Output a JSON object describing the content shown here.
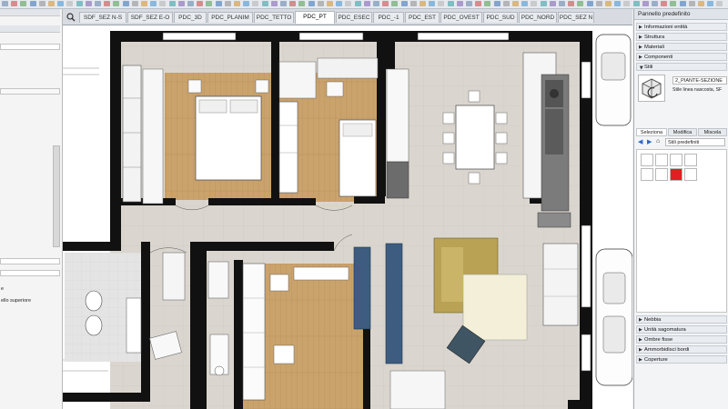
{
  "tabs": [
    {
      "label": "SDF_SEZ N-S",
      "active": false
    },
    {
      "label": "SDF_SEZ E-O",
      "active": false
    },
    {
      "label": "PDC_3D",
      "active": false
    },
    {
      "label": "PDC_PLANIM",
      "active": false
    },
    {
      "label": "PDC_TETTO",
      "active": false
    },
    {
      "label": "PDC_PT",
      "active": true
    },
    {
      "label": "PDC_ESEC",
      "active": false
    },
    {
      "label": "PDC_-1",
      "active": false
    },
    {
      "label": "PDC_EST",
      "active": false
    },
    {
      "label": "PDC_OVEST",
      "active": false
    },
    {
      "label": "PDC_SUD",
      "active": false
    },
    {
      "label": "PDC_NORD",
      "active": false
    },
    {
      "label": "PDC_SEZ N",
      "active": false
    }
  ],
  "left_panel": {
    "labels": [
      {
        "text": "e"
      },
      {
        "text": "ello superiore"
      }
    ]
  },
  "right_panel": {
    "title": "Pannello predefinito",
    "sections_top": [
      {
        "label": "Informazioni entità",
        "open": false
      },
      {
        "label": "Struttura",
        "open": false
      },
      {
        "label": "Materiali",
        "open": false
      },
      {
        "label": "Componenti",
        "open": false
      },
      {
        "label": "Stili",
        "open": true
      }
    ],
    "style_name": "2_PIANTE-SEZIONE",
    "style_desc": "Stile linea nascosta, SF",
    "subtabs": [
      {
        "label": "Seleziona",
        "active": true
      },
      {
        "label": "Modifica",
        "active": false
      },
      {
        "label": "Miscela",
        "active": false
      }
    ],
    "breadcrumb": "Stili predefiniti",
    "sections_bottom": [
      {
        "label": "Nebbia"
      },
      {
        "label": "Unità sagomatura"
      },
      {
        "label": "Ombre fisse"
      },
      {
        "label": "Ammorbidisci bordi"
      },
      {
        "label": "Coperture"
      }
    ]
  },
  "colors": {
    "wood": "#c9a06a",
    "tile": "#d9d5cd",
    "wall": "#111111",
    "sofa": "#b9a254",
    "accent_red": "#e02020",
    "blue_cabinet": "#3d5c80"
  }
}
